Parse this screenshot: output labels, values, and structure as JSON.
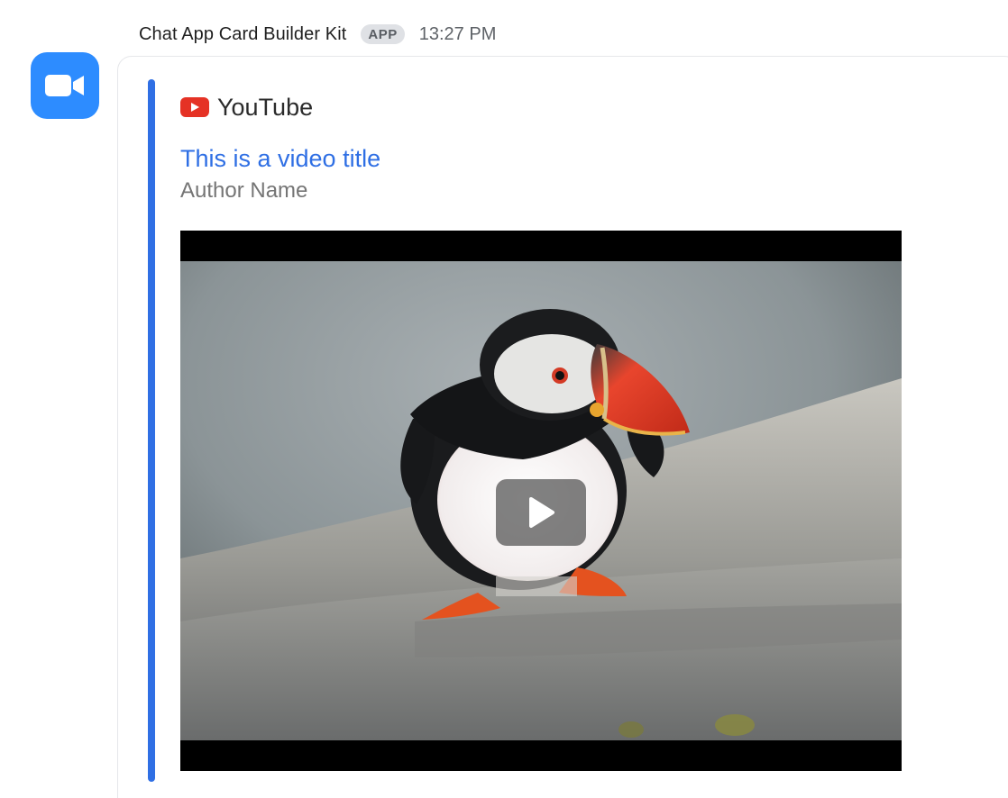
{
  "message": {
    "sender": "Chat App Card Builder Kit",
    "badge": "APP",
    "time": "13:27 PM"
  },
  "avatar": {
    "icon": "video-camera-icon",
    "color": "#2d8cff"
  },
  "card": {
    "accent_color": "#2f6fe4",
    "provider": {
      "icon": "youtube-icon",
      "name": "YouTube"
    },
    "title": "This is a video title",
    "author": "Author Name",
    "video": {
      "thumbnail": "puffin on a rock",
      "play_icon": "play-icon"
    }
  }
}
